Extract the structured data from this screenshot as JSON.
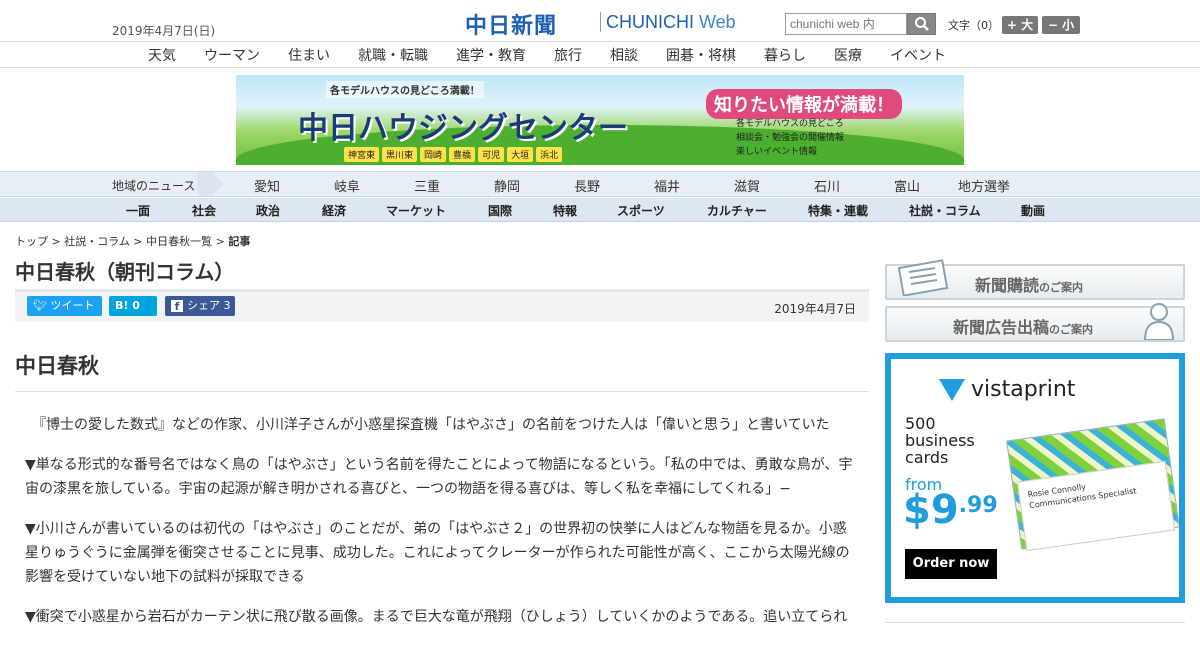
{
  "header": {
    "date": "2019年4月7日(日)",
    "logo_ja": "中日新聞",
    "logo_en_a": "CHUNICHI",
    "logo_en_b": " Web",
    "search_placeholder": "chunichi web 内",
    "fontsize_label": "文字（0）",
    "font_larger": "+ 大",
    "font_smaller": "− 小"
  },
  "category_nav": [
    "天気",
    "ウーマン",
    "住まい",
    "就職・転職",
    "進学・教育",
    "旅行",
    "相談",
    "囲碁・将棋",
    "暮らし",
    "医療",
    "イベント"
  ],
  "banner": {
    "subtitle": "各モデルハウスの見どころ満載！",
    "title": "中日ハウジングセンター",
    "badge": "知りたい情報が満載！",
    "info": [
      "各モデルハウスの見どころ",
      "相談会・勉強会の開催情報",
      "楽しいイベント情報"
    ],
    "cities": [
      "神宮東",
      "黒川東",
      "岡崎",
      "豊橋",
      "可児",
      "大垣",
      "浜北"
    ]
  },
  "region_nav": {
    "label": "地域のニュース",
    "items": [
      "愛知",
      "岐阜",
      "三重",
      "静岡",
      "長野",
      "福井",
      "滋賀",
      "石川",
      "富山",
      "地方選挙"
    ]
  },
  "main_nav": [
    "一面",
    "社会",
    "政治",
    "経済",
    "マーケット",
    "国際",
    "特報",
    "スポーツ",
    "カルチャー",
    "特集・連載",
    "社説・コラム",
    "動画"
  ],
  "breadcrumb": {
    "items": [
      "トップ",
      "社説・コラム",
      "中日春秋一覧"
    ],
    "current": "記事",
    "sep": " > "
  },
  "article": {
    "heading": "中日春秋（朝刊コラム）",
    "share": {
      "tweet": "ツイート",
      "hatena": "B! 0",
      "facebook": "シェア 3"
    },
    "date": "2019年4月7日",
    "title": "中日春秋",
    "paragraphs": [
      "　『博士の愛した数式』などの作家、小川洋子さんが小惑星探査機「はやぶさ」の名前をつけた人は「偉いと思う」と書いていた",
      "▼単なる形式的な番号名ではなく鳥の「はやぶさ」という名前を得たことによって物語になるという。「私の中では、勇敢な鳥が、宇宙の漆黒を旅している。宇宙の起源が解き明かされる喜びと、一つの物語を得る喜びは、等しく私を幸福にしてくれる」−",
      "▼小川さんが書いているのは初代の「はやぶさ」のことだが、弟の「はやぶさ２」の世界初の快挙に人はどんな物語を見るか。小惑星りゅうぐうに金属弾を衝突させることに見事、成功した。これによってクレーターが作られた可能性が高く、ここから太陽光線の影響を受けていない地下の試料が採取できる",
      "▼衝突で小惑星から岩石がカーテン状に飛び散る画像。まるで巨大な竜が飛翔（ひしょう）していくかのようである。追い立てられ"
    ]
  },
  "sidebar": {
    "subscribe": "新聞購読",
    "subscribe_small": "のご案内",
    "advert": "新聞広告出稿",
    "advert_small": "のご案内"
  },
  "ad": {
    "brand": "vistaprint",
    "line1": "500",
    "line2": "business",
    "line3": "cards",
    "from": "from",
    "price": "$9",
    "price_cents": ".99",
    "button": "Order now",
    "card_name": "Rosie Connolly",
    "card_title": "Communications Specialist"
  },
  "colors": {
    "brand_blue": "#1d5fb4",
    "ad_blue": "#1f9dde",
    "twitter": "#1da1f2",
    "hatena": "#00a4de",
    "facebook": "#3b5998"
  }
}
